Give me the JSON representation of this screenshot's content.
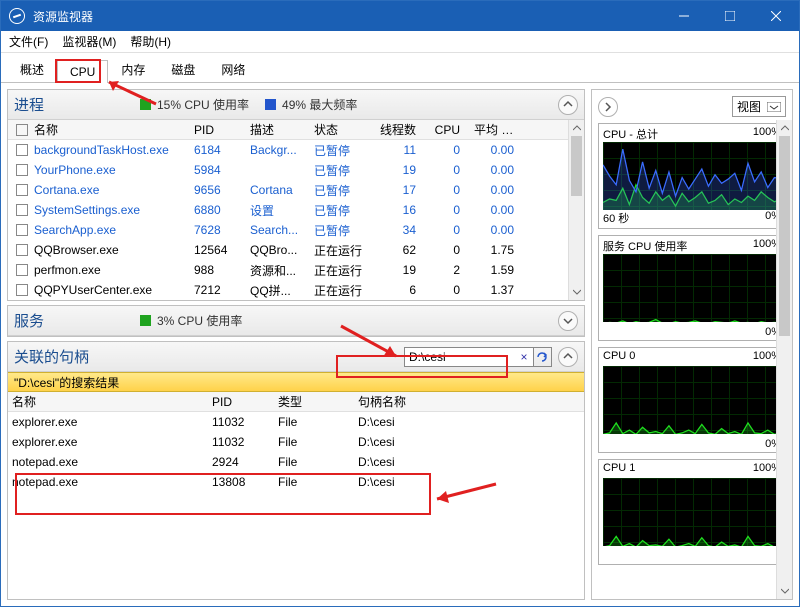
{
  "window": {
    "title": "资源监视器"
  },
  "menu": {
    "file": "文件(F)",
    "monitor": "监视器(M)",
    "help": "帮助(H)"
  },
  "tabs": {
    "overview": "概述",
    "cpu": "CPU",
    "memory": "内存",
    "disk": "磁盘",
    "network": "网络"
  },
  "processes": {
    "title": "进程",
    "stat1": "15% CPU 使用率",
    "stat2": "49% 最大频率",
    "columns": {
      "name": "名称",
      "pid": "PID",
      "desc": "描述",
      "status": "状态",
      "threads": "线程数",
      "cpu": "CPU",
      "avg": "平均 C..."
    },
    "rows": [
      {
        "name": "backgroundTaskHost.exe",
        "pid": "6184",
        "desc": "Backgr...",
        "status": "已暂停",
        "threads": "11",
        "cpu": "0",
        "avg": "0.00",
        "link": true
      },
      {
        "name": "YourPhone.exe",
        "pid": "5984",
        "desc": "",
        "status": "已暂停",
        "threads": "19",
        "cpu": "0",
        "avg": "0.00",
        "link": true
      },
      {
        "name": "Cortana.exe",
        "pid": "9656",
        "desc": "Cortana",
        "status": "已暂停",
        "threads": "17",
        "cpu": "0",
        "avg": "0.00",
        "link": true
      },
      {
        "name": "SystemSettings.exe",
        "pid": "6880",
        "desc": "设置",
        "status": "已暂停",
        "threads": "16",
        "cpu": "0",
        "avg": "0.00",
        "link": true
      },
      {
        "name": "SearchApp.exe",
        "pid": "7628",
        "desc": "Search...",
        "status": "已暂停",
        "threads": "34",
        "cpu": "0",
        "avg": "0.00",
        "link": true
      },
      {
        "name": "QQBrowser.exe",
        "pid": "12564",
        "desc": "QQBro...",
        "status": "正在运行",
        "threads": "62",
        "cpu": "0",
        "avg": "1.75",
        "link": false
      },
      {
        "name": "perfmon.exe",
        "pid": "988",
        "desc": "资源和...",
        "status": "正在运行",
        "threads": "19",
        "cpu": "2",
        "avg": "1.59",
        "link": false
      },
      {
        "name": "QQPYUserCenter.exe",
        "pid": "7212",
        "desc": "QQ拼...",
        "status": "正在运行",
        "threads": "6",
        "cpu": "0",
        "avg": "1.37",
        "link": false
      }
    ]
  },
  "services": {
    "title": "服务",
    "stat1": "3% CPU 使用率"
  },
  "handles": {
    "title": "关联的句柄",
    "search_value": "D:\\cesi",
    "results_label": "\"D:\\cesi\"的搜索结果",
    "columns": {
      "name": "名称",
      "pid": "PID",
      "type": "类型",
      "hname": "句柄名称"
    },
    "rows": [
      {
        "name": "explorer.exe",
        "pid": "11032",
        "type": "File",
        "hname": "D:\\cesi"
      },
      {
        "name": "explorer.exe",
        "pid": "11032",
        "type": "File",
        "hname": "D:\\cesi"
      },
      {
        "name": "notepad.exe",
        "pid": "2924",
        "type": "File",
        "hname": "D:\\cesi"
      },
      {
        "name": "notepad.exe",
        "pid": "13808",
        "type": "File",
        "hname": "D:\\cesi"
      }
    ]
  },
  "right": {
    "view_label": "视图",
    "charts": [
      {
        "title": "CPU - 总计",
        "right": "100%",
        "foot_l": "60 秒",
        "foot_r": "0%"
      },
      {
        "title": "服务 CPU 使用率",
        "right": "100%",
        "foot_l": "",
        "foot_r": "0%"
      },
      {
        "title": "CPU 0",
        "right": "100%",
        "foot_l": "",
        "foot_r": "0%"
      },
      {
        "title": "CPU 1",
        "right": "100%",
        "foot_l": "",
        "foot_r": ""
      }
    ]
  },
  "chart_data": [
    {
      "type": "line",
      "title": "CPU - 总计",
      "xlabel": "60 秒",
      "ylabel": "",
      "ylim": [
        0,
        100
      ],
      "series": [
        {
          "name": "CPU 使用率",
          "color": "#1fe01f",
          "values": [
            15,
            20,
            18,
            35,
            12,
            40,
            22,
            14,
            30,
            18,
            25,
            10,
            28,
            16,
            22,
            30,
            14,
            18,
            26,
            12,
            20,
            15,
            24,
            18,
            30,
            22,
            16,
            20
          ]
        },
        {
          "name": "最大频率",
          "color": "#3a6cff",
          "values": [
            68,
            52,
            40,
            90,
            46,
            30,
            72,
            35,
            60,
            28,
            58,
            24,
            50,
            34,
            48,
            62,
            38,
            54,
            42,
            48,
            56,
            32,
            70,
            44,
            58,
            36,
            50,
            49
          ]
        }
      ]
    },
    {
      "type": "line",
      "title": "服务 CPU 使用率",
      "ylim": [
        0,
        100
      ],
      "series": [
        {
          "name": "CPU",
          "color": "#1fe01f",
          "values": [
            2,
            4,
            3,
            6,
            2,
            5,
            3,
            4,
            8,
            3,
            2,
            5,
            3,
            4,
            6,
            3,
            2,
            5,
            4,
            3,
            6,
            3,
            4,
            2,
            5,
            3,
            4,
            3
          ]
        }
      ]
    },
    {
      "type": "line",
      "title": "CPU 0",
      "ylim": [
        0,
        100
      ],
      "series": [
        {
          "name": "CPU",
          "color": "#1fe01f",
          "values": [
            4,
            6,
            20,
            5,
            10,
            4,
            14,
            6,
            8,
            5,
            16,
            4,
            6,
            10,
            5,
            18,
            6,
            4,
            12,
            5,
            8,
            4,
            20,
            6,
            5,
            10,
            4,
            6
          ]
        }
      ]
    },
    {
      "type": "line",
      "title": "CPU 1",
      "ylim": [
        0,
        100
      ],
      "series": [
        {
          "name": "CPU",
          "color": "#1fe01f",
          "values": [
            3,
            5,
            18,
            4,
            8,
            3,
            12,
            5,
            6,
            4,
            14,
            3,
            5,
            8,
            4,
            16,
            5,
            3,
            10,
            4,
            6,
            3,
            18,
            5,
            4,
            8,
            3,
            5
          ]
        }
      ]
    }
  ]
}
